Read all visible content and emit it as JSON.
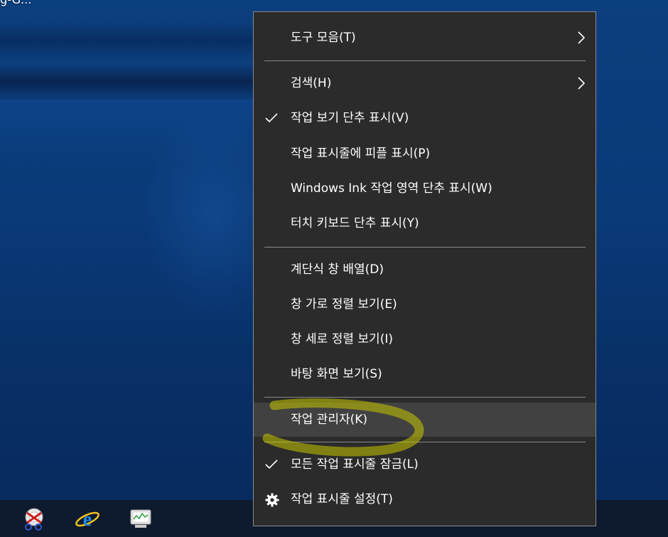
{
  "desktop": {
    "label": "ng-G..."
  },
  "menu": {
    "items": [
      {
        "label": "도구 모음(T)",
        "submenu": true,
        "checked": false
      },
      {
        "label": "검색(H)",
        "submenu": true,
        "checked": false
      },
      {
        "label": "작업 보기 단추 표시(V)",
        "submenu": false,
        "checked": true
      },
      {
        "label": "작업 표시줄에 피플 표시(P)",
        "submenu": false,
        "checked": false
      },
      {
        "label": "Windows Ink 작업 영역 단추 표시(W)",
        "submenu": false,
        "checked": false
      },
      {
        "label": "터치 키보드 단추 표시(Y)",
        "submenu": false,
        "checked": false
      },
      {
        "label": "계단식 창 배열(D)",
        "submenu": false,
        "checked": false
      },
      {
        "label": "창 가로 정렬 보기(E)",
        "submenu": false,
        "checked": false
      },
      {
        "label": "창 세로 정렬 보기(I)",
        "submenu": false,
        "checked": false
      },
      {
        "label": "바탕 화면 보기(S)",
        "submenu": false,
        "checked": false
      },
      {
        "label": "작업 관리자(K)",
        "submenu": false,
        "checked": false,
        "hovered": true
      },
      {
        "label": "모든 작업 표시줄 잠금(L)",
        "submenu": false,
        "checked": true
      },
      {
        "label": "작업 표시줄 설정(T)",
        "submenu": false,
        "checked": false,
        "icon": "gear-icon"
      }
    ]
  },
  "taskbar": {
    "icons": [
      "snipping-tool-icon",
      "internet-explorer-icon",
      "performance-monitor-icon"
    ]
  },
  "colors": {
    "menu_bg": "#2b2b2b",
    "menu_hover": "#414141",
    "menu_border": "#8a8a8a",
    "highlight_marker": "#c8c800",
    "desktop_blue": "#0a3a78"
  }
}
